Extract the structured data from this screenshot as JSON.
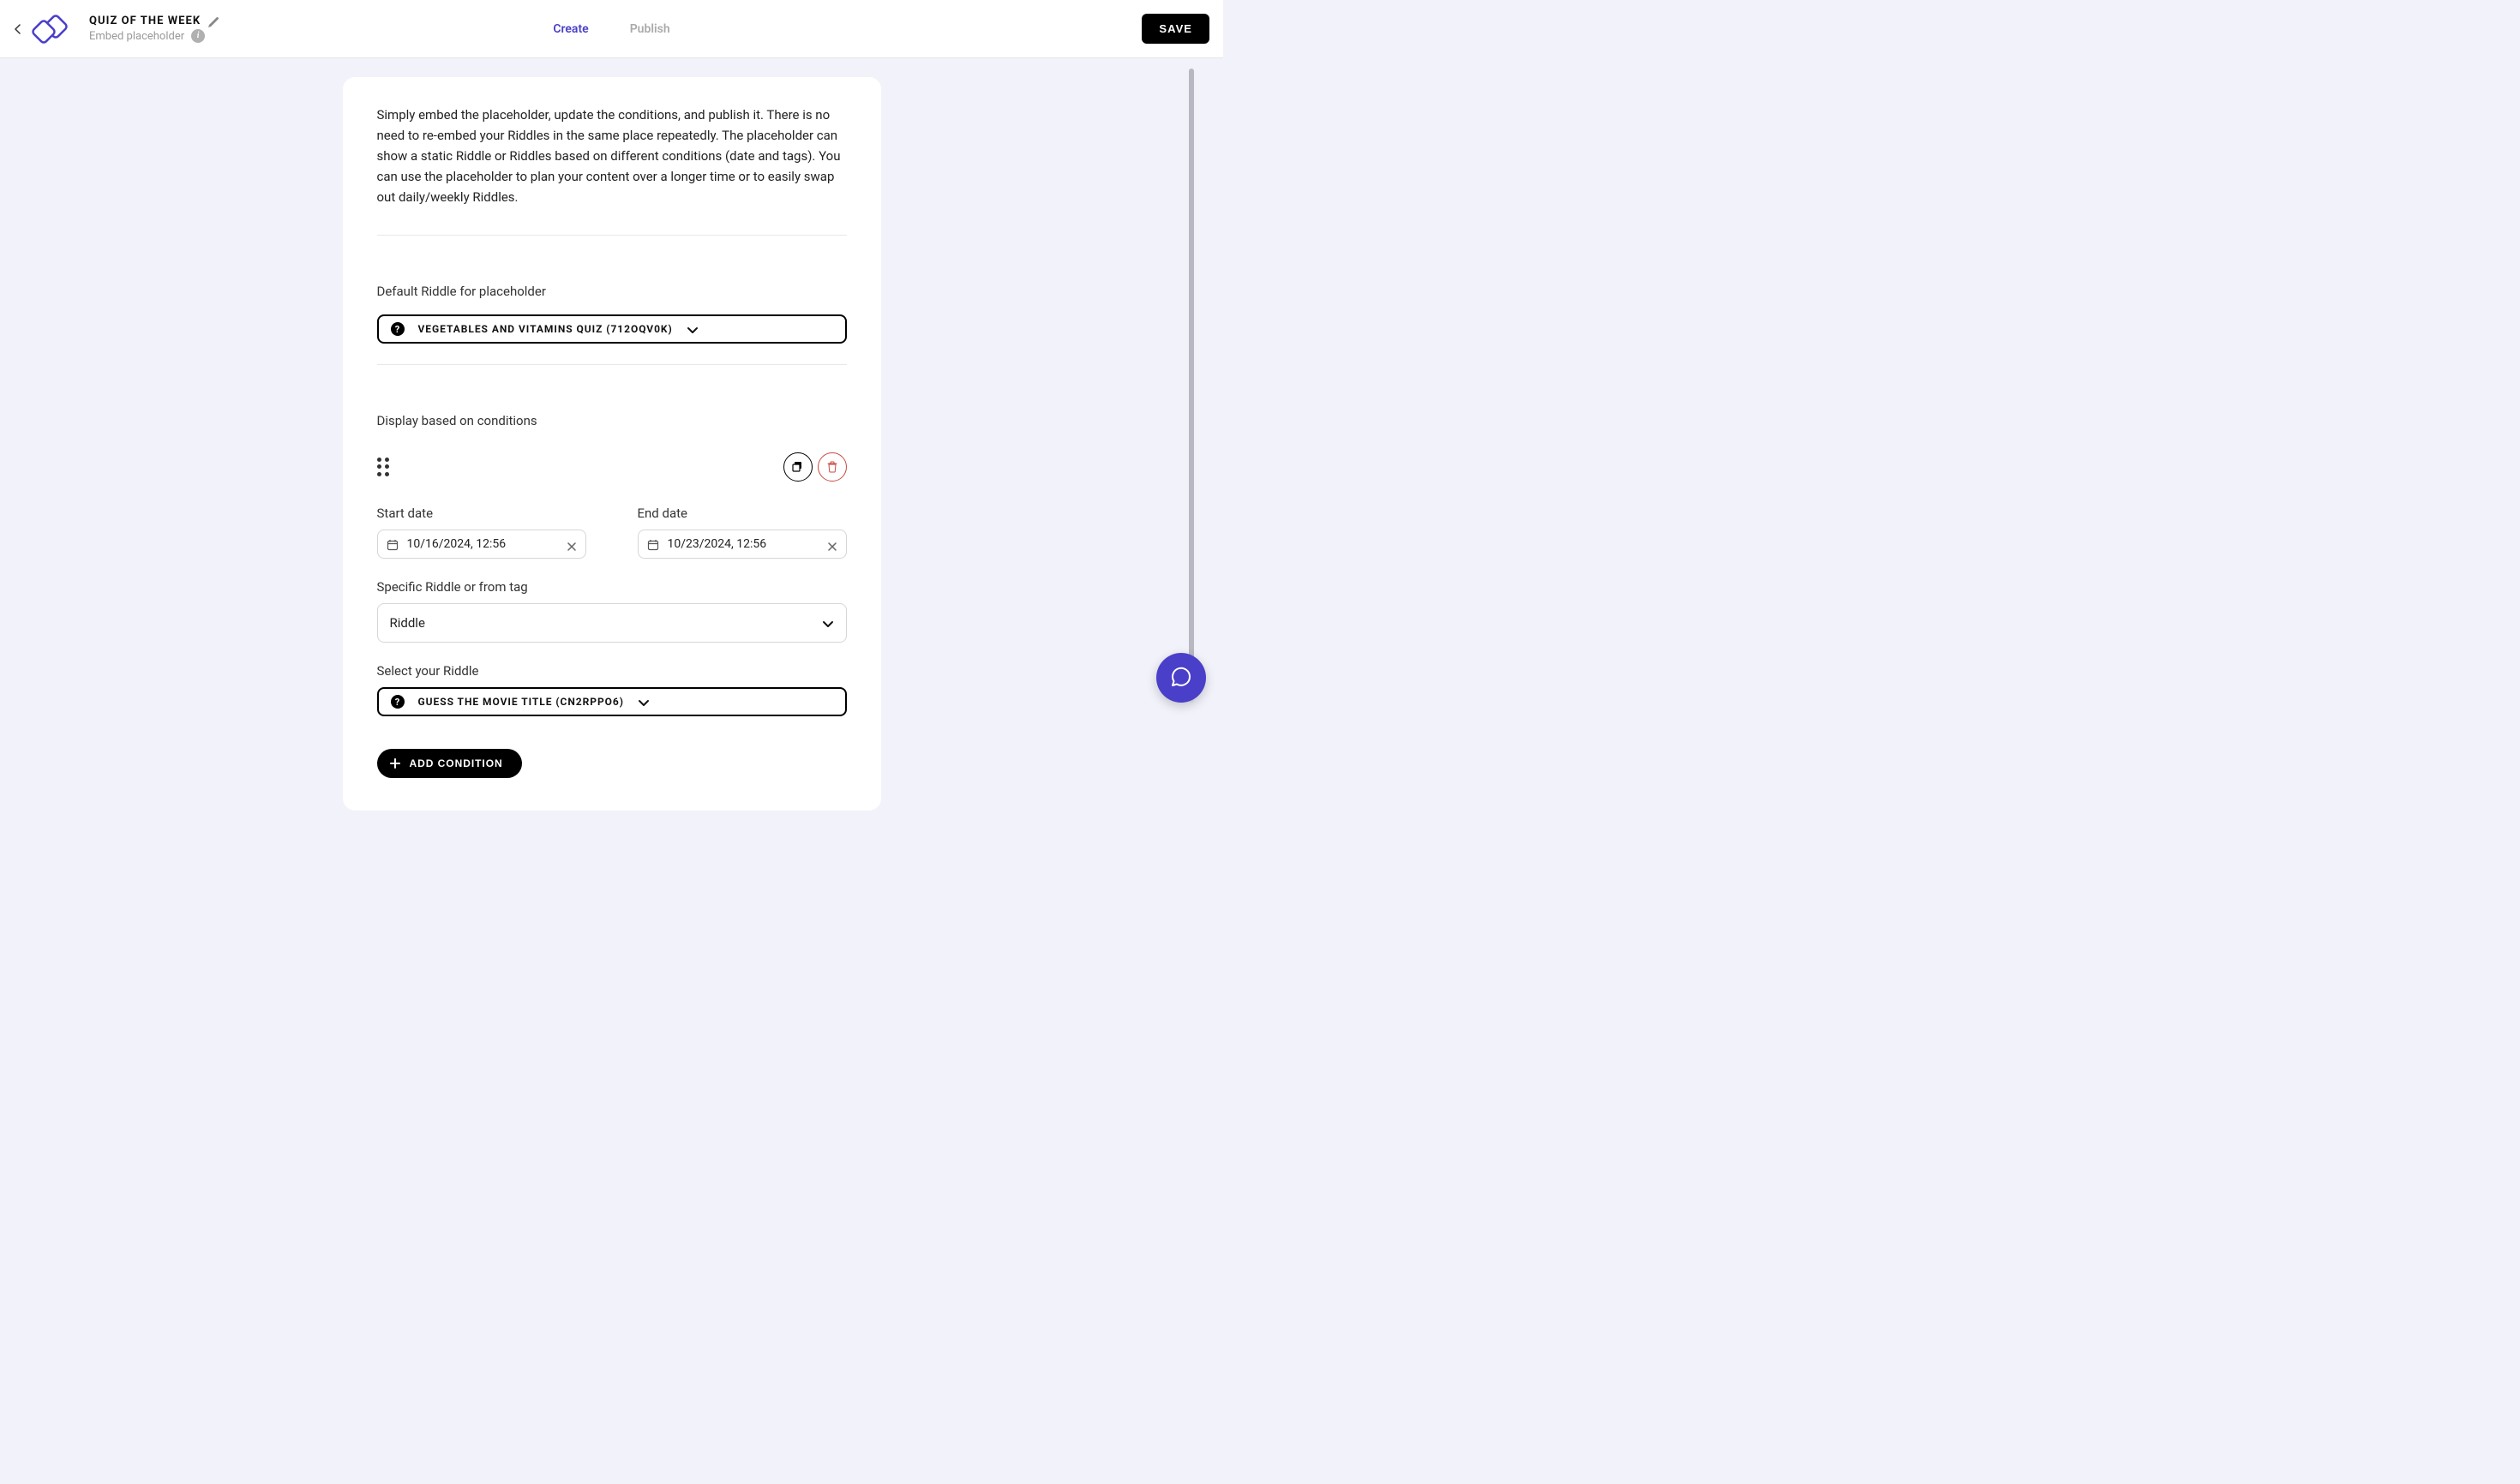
{
  "header": {
    "title": "QUIZ OF THE WEEK",
    "subtitle": "Embed placeholder"
  },
  "tabs": {
    "create": "Create",
    "publish": "Publish"
  },
  "saveLabel": "SAVE",
  "intro": "Simply embed the placeholder, update the conditions, and publish it. There is no need to re-embed your Riddles in the same place repeatedly. The placeholder can show a static Riddle or Riddles based on different conditions (date and tags). You can use the placeholder to plan your content over a longer time or to easily swap out daily/weekly Riddles.",
  "defaultRiddle": {
    "label": "Default Riddle for placeholder",
    "value": "VEGETABLES AND VITAMINS QUIZ (712OQV0K)"
  },
  "conditionsLabel": "Display based on conditions",
  "condition": {
    "startLabel": "Start date",
    "startValue": "10/16/2024, 12:56",
    "endLabel": "End date",
    "endValue": "10/23/2024, 12:56",
    "specificLabel": "Specific Riddle or from tag",
    "specificValue": "Riddle",
    "selectLabel": "Select your Riddle",
    "selectValue": "GUESS THE MOVIE TITLE (CN2RPPO6)"
  },
  "addConditionLabel": "ADD CONDITION"
}
